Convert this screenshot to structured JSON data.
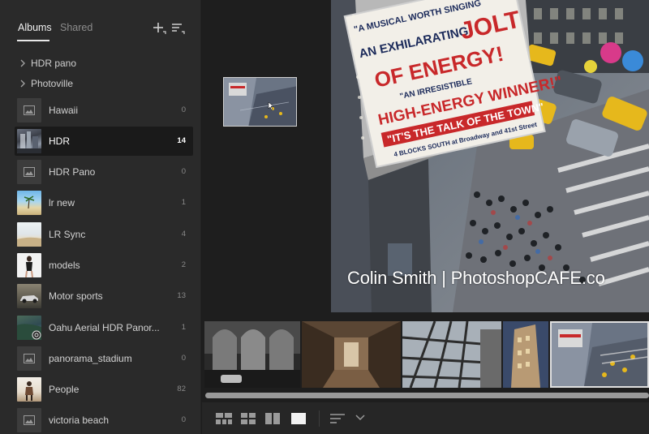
{
  "sidebar": {
    "tabs": [
      {
        "label": "Albums",
        "active": true
      },
      {
        "label": "Shared",
        "active": false
      }
    ],
    "folders": [
      {
        "label": "HDR pano"
      },
      {
        "label": "Photoville"
      }
    ],
    "albums": [
      {
        "label": "Hawaii",
        "count": "0",
        "thumb": "placeholder"
      },
      {
        "label": "HDR",
        "count": "14",
        "thumb": "hdr",
        "selected": true
      },
      {
        "label": "HDR Pano",
        "count": "0",
        "thumb": "placeholder"
      },
      {
        "label": "lr new",
        "count": "1",
        "thumb": "beach"
      },
      {
        "label": "LR Sync",
        "count": "4",
        "thumb": "sand"
      },
      {
        "label": "models",
        "count": "2",
        "thumb": "model"
      },
      {
        "label": "Motor sports",
        "count": "13",
        "thumb": "car"
      },
      {
        "label": "Oahu Aerial HDR Panor...",
        "count": "1",
        "thumb": "aerial"
      },
      {
        "label": "panorama_stadium",
        "count": "0",
        "thumb": "placeholder"
      },
      {
        "label": "People",
        "count": "82",
        "thumb": "people"
      },
      {
        "label": "victoria beach",
        "count": "0",
        "thumb": "placeholder"
      }
    ]
  },
  "preview": {
    "watermark": "Colin Smith | PhotoshopCAFE.co",
    "sign": {
      "line1": "\"A MUSICAL WORTH SINGING",
      "line2": "AN EXHILARATING",
      "line3": "JOLT",
      "line4": "OF ENERGY!",
      "line5": "\"AN IRRESISTIBLE",
      "line6": "HIGH-ENERGY WINNER!\"",
      "line7": "\"IT'S THE TALK OF THE TOWN\"",
      "line8": "4 BLOCKS SOUTH at Broadway and 41st Street"
    }
  },
  "icons": {
    "add": "add-album-icon",
    "sort": "sort-icon",
    "folder_chevron": "chevron-right-icon",
    "album_placeholder": "image-placeholder-icon"
  },
  "colors": {
    "sidebar_bg": "#2a2a2a",
    "main_bg": "#1e1e1e",
    "selected_row": "#1a1a1a",
    "sign_red": "#c8282a",
    "taxi": "#e6b81c"
  }
}
